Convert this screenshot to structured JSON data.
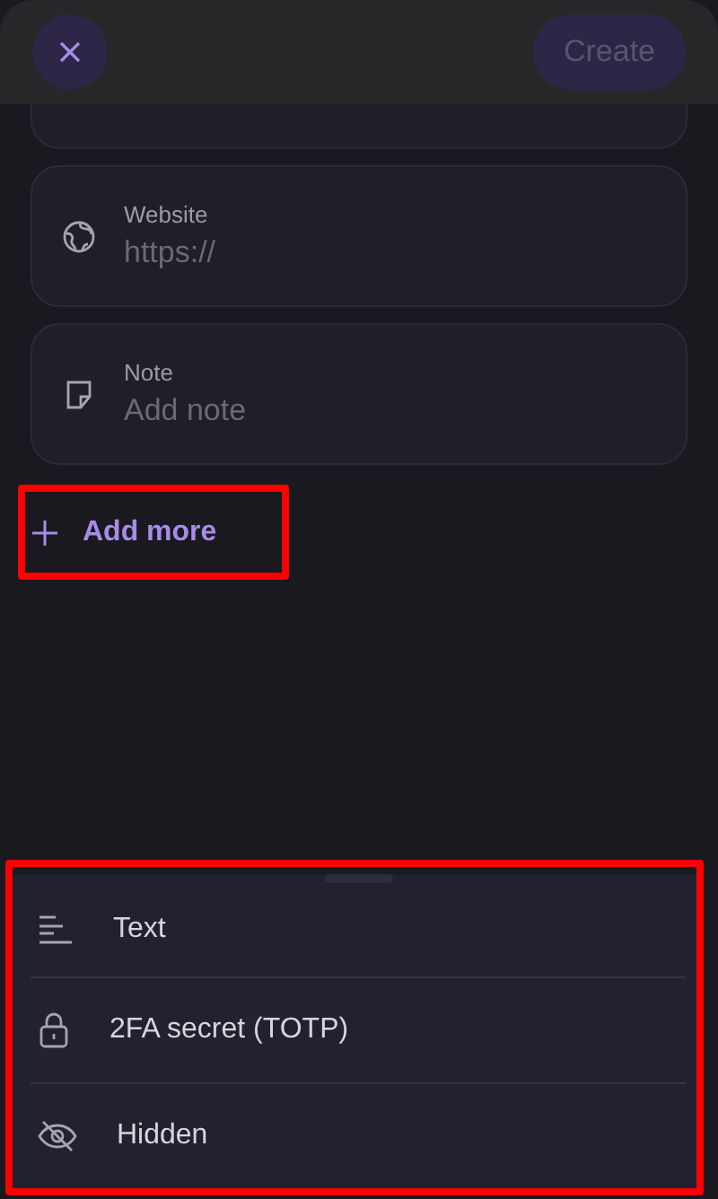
{
  "header": {
    "create_button": {
      "label": "Create",
      "disabled": true
    }
  },
  "fields": [
    {
      "kind": "website",
      "label": "Website",
      "placeholder": "https://"
    },
    {
      "kind": "note",
      "label": "Note",
      "placeholder": "Add note"
    }
  ],
  "add_more": {
    "label": "Add more"
  },
  "sheet": {
    "options": [
      {
        "kind": "text",
        "label": "Text"
      },
      {
        "kind": "totp",
        "label": "2FA secret (TOTP)"
      },
      {
        "kind": "hidden",
        "label": "Hidden"
      }
    ]
  }
}
